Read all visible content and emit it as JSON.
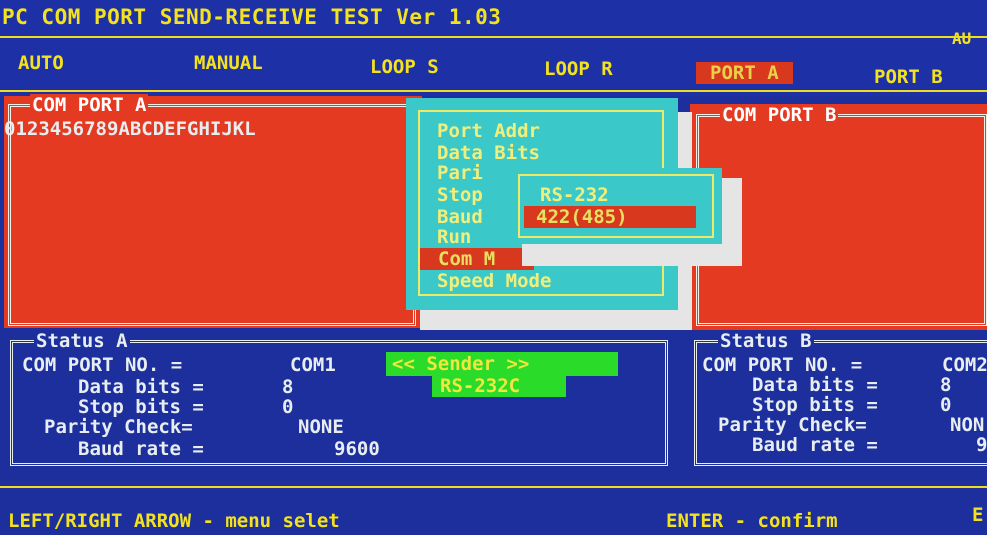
{
  "app": {
    "title": "PC COM PORT SEND-RECEIVE TEST Ver 1.03",
    "title_right": "AU"
  },
  "menu": {
    "items": [
      {
        "label": "AUTO"
      },
      {
        "label": "MANUAL"
      },
      {
        "label": "LOOP S"
      },
      {
        "label": "LOOP R"
      },
      {
        "label": "PORT A"
      },
      {
        "label": "PORT B"
      }
    ],
    "active": "PORT A"
  },
  "port_a": {
    "label": "COM PORT A",
    "data_line": "0123456789ABCDEFGHIJKL"
  },
  "port_b": {
    "label": "COM PORT B"
  },
  "popup_menu": {
    "items": [
      "Port Addr",
      "Data Bits",
      "Pari",
      "Stop",
      "Baud",
      "Run",
      "Com M",
      "Speed Mode"
    ],
    "highlighted": "Com M"
  },
  "sub_menu": {
    "items": [
      "RS-232",
      "422(485)"
    ],
    "selected": "422(485)"
  },
  "status_a": {
    "label": "Status A",
    "com_port_label": "COM PORT NO.  =",
    "com_port_value": "COM1",
    "data_bits_label": "Data bits =",
    "data_bits_value": "8",
    "stop_bits_label": "Stop bits =",
    "stop_bits_value": "0",
    "parity_label": "Parity Check=",
    "parity_value": "NONE",
    "baud_label": "Baud rate =",
    "baud_value": "9600",
    "mode_badge": "<<  Sender  >>",
    "interface_badge": "RS-232C"
  },
  "status_b": {
    "label": "Status B",
    "com_port_label": "COM PORT NO.  =",
    "com_port_value": "COM2",
    "data_bits_label": "Data bits =",
    "data_bits_value": "8",
    "stop_bits_label": "Stop bits =",
    "stop_bits_value": "0",
    "parity_label": "Parity Check=",
    "parity_value": "NON",
    "baud_label": "Baud rate =",
    "baud_value": "9"
  },
  "footer": {
    "hint_left": "LEFT/RIGHT ARROW - menu selet",
    "hint_right": "ENTER - confirm",
    "hint_edge": "E"
  },
  "colors": {
    "background": "#1c2f9c",
    "text_yellow": "#f4e21e",
    "panel_red": "#e43a22",
    "popup_cyan": "#3ac9c8",
    "highlight_green": "#2adb2a"
  }
}
